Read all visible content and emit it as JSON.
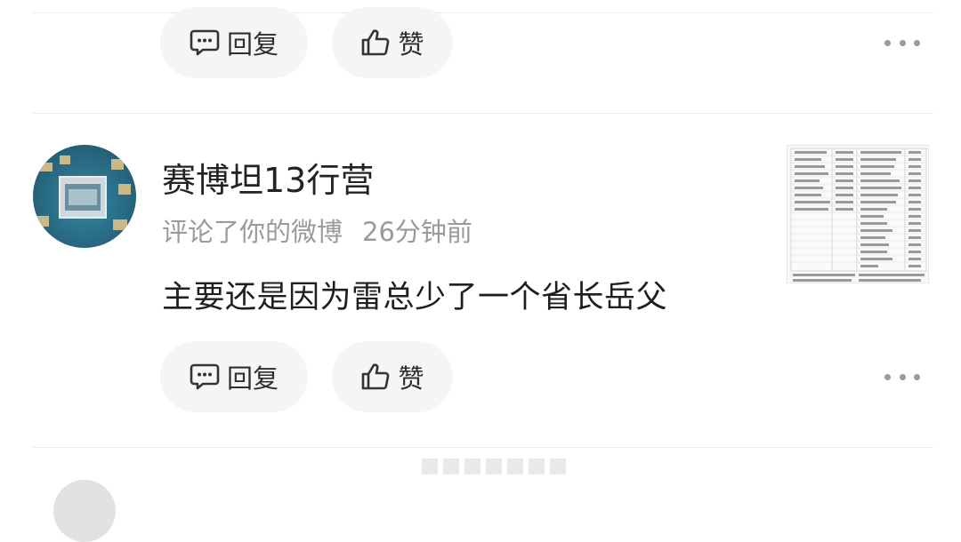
{
  "top_actions": {
    "reply_label": "回复",
    "like_label": "赞"
  },
  "comment": {
    "username": "赛博坦13行营",
    "action_text": "评论了你的微博",
    "time": "26分钟前",
    "content": "主要还是因为雷总少了一个省长岳父",
    "reply_label": "回复",
    "like_label": "赞"
  },
  "icons": {
    "reply": "comment-bubble-icon",
    "like": "thumbs-up-icon",
    "more": "more-dots-icon"
  },
  "colors": {
    "pill_bg": "#f5f5f5",
    "meta_text": "#9a9a9a",
    "divider": "#ececec"
  }
}
